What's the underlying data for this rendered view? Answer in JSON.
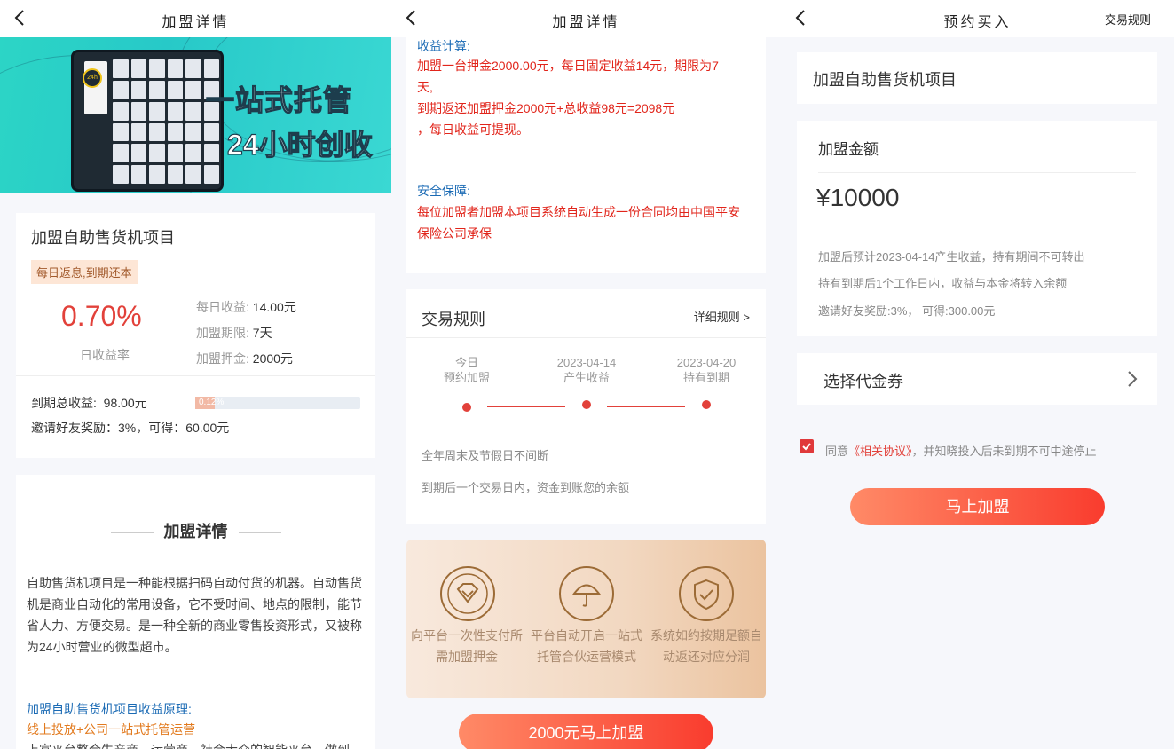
{
  "screen1": {
    "nav_title": "加盟详情",
    "banner": {
      "line1": "一站式托管",
      "line2": "24小时创收",
      "badge": "24h"
    },
    "product": {
      "name": "加盟自助售货机项目",
      "tag": "每日返息,到期还本",
      "rate": "0.70%",
      "rate_label": "日收益率",
      "daily_income_label": "每日收益:",
      "daily_income_value": "14.00元",
      "period_label": "加盟期限:",
      "period_value": "7天",
      "deposit_label": "加盟押金:",
      "deposit_value": "2000元",
      "total_label": "到期总收益:",
      "total_value": "98.00元",
      "progress_pct": "0.12%",
      "progress_fraction": 0.12,
      "invite_text": "邀请好友奖励：3%，可得：60.00元"
    },
    "details": {
      "title": "加盟详情",
      "intro": "自助售货机项目是一种能根据扫码自动付货的机器。自动售货机是商业自动化的常用设备，它不受时间、地点的限制，能节省人力、方便交易。是一种全新的商业零售投资形式，又被称为24小时营业的微型超市。",
      "principle_title": "加盟自助售货机项目收益原理:",
      "principle_line": "线上投放+公司一站式托管运营",
      "principle_cut": "上富平台整合生产商、运营商、社会大众的智能平台，做到"
    }
  },
  "screen2": {
    "nav_title": "加盟详情",
    "calc_title": "收益计算:",
    "calc_lines": [
      "加盟一台押金2000.00元，每日固定收益14元，期限为7",
      "天,",
      "到期返还加盟押金2000元+总收益98元=2098元",
      "，每日收益可提现。"
    ],
    "safety_title": "安全保障:",
    "safety_lines": [
      "每位加盟者加盟本项目系统自动生成一份合同均由中国平安",
      "保险公司承保"
    ],
    "rules_title": "交易规则",
    "rules_link": "详细规则 >",
    "steps": [
      {
        "top": "今日",
        "bottom": "预约加盟"
      },
      {
        "top": "2023-04-14",
        "bottom": "产生收益"
      },
      {
        "top": "2023-04-20",
        "bottom": "持有到期"
      }
    ],
    "note1": "全年周末及节假日不间断",
    "note2": "到期后一个交易日内，资金到账您的余额",
    "features": [
      {
        "icon": "diamond-icon",
        "line1": "向平台一次性支付所",
        "line2": "需加盟押金"
      },
      {
        "icon": "umbrella-icon",
        "line1": "平台自动开启一站式",
        "line2": "托管合伙运营模式"
      },
      {
        "icon": "shield-check-icon",
        "line1": "系统如约按期足额自",
        "line2": "动返还对应分润"
      }
    ],
    "cta": "2000元马上加盟"
  },
  "screen3": {
    "nav_title": "预约买入",
    "nav_right": "交易规则",
    "product_name": "加盟自助售货机项目",
    "amount_label": "加盟金额",
    "amount_value": "¥10000",
    "info1": "加盟后预计2023-04-14产生收益，持有期间不可转出",
    "info2": "持有到期后1个工作日内，收益与本金将转入余额",
    "info3": "邀请好友奖励:3%， 可得:300.00元",
    "coupon_label": "选择代金券",
    "agree_prefix": "同意",
    "agree_link": "《相关协议》",
    "agree_suffix": "，并知晓投入后未到期不可中途停止",
    "cta": "马上加盟"
  },
  "colors": {
    "accent_red": "#e2413a",
    "link_blue": "#1a6ab4",
    "gold": "#9c6b36"
  }
}
